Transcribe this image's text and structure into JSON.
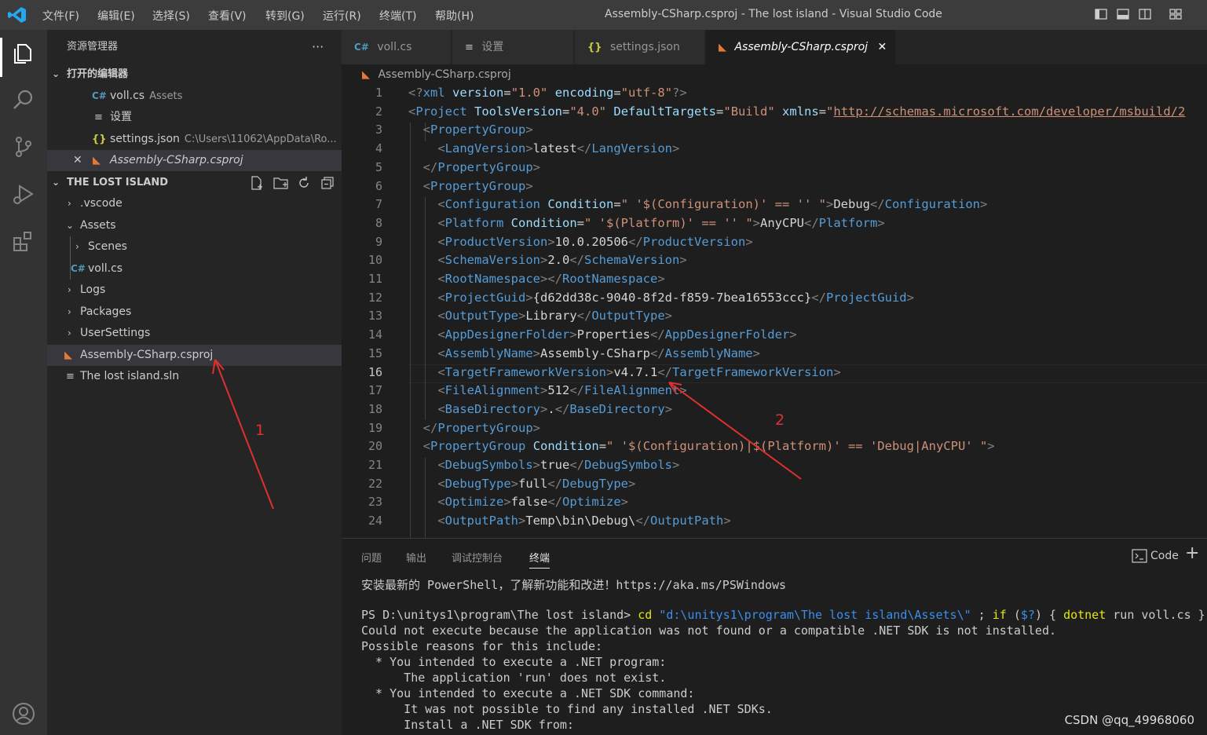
{
  "titlebar": {
    "menus": [
      "文件(F)",
      "编辑(E)",
      "选择(S)",
      "查看(V)",
      "转到(G)",
      "运行(R)",
      "终端(T)",
      "帮助(H)"
    ],
    "title": "Assembly-CSharp.csproj - The lost island - Visual Studio Code"
  },
  "sidebar": {
    "title": "资源管理器",
    "more": "···",
    "open_editors_header": "打开的编辑器",
    "open_editors": [
      {
        "name": "voll.cs",
        "desc": "Assets",
        "icon": "csharp-icon"
      },
      {
        "name": "设置",
        "desc": "",
        "icon": "settings-lines-icon"
      },
      {
        "name": "settings.json",
        "desc": "C:\\Users\\11062\\AppData\\Ro...",
        "icon": "json-icon"
      },
      {
        "name": "Assembly-CSharp.csproj",
        "desc": "",
        "icon": "rss-icon",
        "close": "✕"
      }
    ],
    "folder_header": "THE LOST ISLAND",
    "tree": [
      {
        "name": ".vscode",
        "chevron": "›"
      },
      {
        "name": "Assets",
        "chevron": "⌄"
      },
      {
        "name": "Scenes",
        "chevron": "›"
      },
      {
        "name": "voll.cs",
        "chevron": ""
      },
      {
        "name": "Logs",
        "chevron": "›"
      },
      {
        "name": "Packages",
        "chevron": "›"
      },
      {
        "name": "UserSettings",
        "chevron": "›"
      },
      {
        "name": "Assembly-CSharp.csproj",
        "chevron": ""
      },
      {
        "name": "The lost island.sln",
        "chevron": ""
      }
    ]
  },
  "tabs": [
    {
      "label": "voll.cs"
    },
    {
      "label": "设置"
    },
    {
      "label": "settings.json"
    },
    {
      "label": "Assembly-CSharp.csproj",
      "close": "✕"
    }
  ],
  "breadcrumb": "Assembly-CSharp.csproj",
  "editor": {
    "current_line": 16,
    "line_numbers": [
      "1",
      "2",
      "3",
      "4",
      "5",
      "6",
      "7",
      "8",
      "9",
      "10",
      "11",
      "12",
      "13",
      "14",
      "15",
      "16",
      "17",
      "18",
      "19",
      "20",
      "21",
      "22",
      "23",
      "24"
    ],
    "lines": [
      [
        [
          "br",
          "<?"
        ],
        [
          "tg",
          "xml"
        ],
        [
          "tx",
          " "
        ],
        [
          "at",
          "version"
        ],
        [
          "tx",
          "="
        ],
        [
          "st",
          "\"1.0\""
        ],
        [
          "tx",
          " "
        ],
        [
          "at",
          "encoding"
        ],
        [
          "tx",
          "="
        ],
        [
          "st",
          "\"utf-8\""
        ],
        [
          "br",
          "?>"
        ]
      ],
      [
        [
          "br",
          "<"
        ],
        [
          "tg",
          "Project"
        ],
        [
          "tx",
          " "
        ],
        [
          "at",
          "ToolsVersion"
        ],
        [
          "tx",
          "="
        ],
        [
          "st",
          "\"4.0\""
        ],
        [
          "tx",
          " "
        ],
        [
          "at",
          "DefaultTargets"
        ],
        [
          "tx",
          "="
        ],
        [
          "st",
          "\"Build\""
        ],
        [
          "tx",
          " "
        ],
        [
          "at",
          "xmlns"
        ],
        [
          "tx",
          "="
        ],
        [
          "st",
          "\""
        ],
        [
          "ur",
          "http://schemas.microsoft.com/developer/msbuild/2"
        ]
      ],
      [
        [
          "tx",
          "  "
        ],
        [
          "br",
          "<"
        ],
        [
          "tg",
          "PropertyGroup"
        ],
        [
          "br",
          ">"
        ]
      ],
      [
        [
          "tx",
          "    "
        ],
        [
          "br",
          "<"
        ],
        [
          "tg",
          "LangVersion"
        ],
        [
          "br",
          ">"
        ],
        [
          "tx",
          "latest"
        ],
        [
          "br",
          "</"
        ],
        [
          "tg",
          "LangVersion"
        ],
        [
          "br",
          ">"
        ]
      ],
      [
        [
          "tx",
          "  "
        ],
        [
          "br",
          "</"
        ],
        [
          "tg",
          "PropertyGroup"
        ],
        [
          "br",
          ">"
        ]
      ],
      [
        [
          "tx",
          "  "
        ],
        [
          "br",
          "<"
        ],
        [
          "tg",
          "PropertyGroup"
        ],
        [
          "br",
          ">"
        ]
      ],
      [
        [
          "tx",
          "    "
        ],
        [
          "br",
          "<"
        ],
        [
          "tg",
          "Configuration"
        ],
        [
          "tx",
          " "
        ],
        [
          "at",
          "Condition"
        ],
        [
          "tx",
          "="
        ],
        [
          "st",
          "\" '$(Configuration)' == '' \""
        ],
        [
          "br",
          ">"
        ],
        [
          "tx",
          "Debug"
        ],
        [
          "br",
          "</"
        ],
        [
          "tg",
          "Configuration"
        ],
        [
          "br",
          ">"
        ]
      ],
      [
        [
          "tx",
          "    "
        ],
        [
          "br",
          "<"
        ],
        [
          "tg",
          "Platform"
        ],
        [
          "tx",
          " "
        ],
        [
          "at",
          "Condition"
        ],
        [
          "tx",
          "="
        ],
        [
          "st",
          "\" '$(Platform)' == '' \""
        ],
        [
          "br",
          ">"
        ],
        [
          "tx",
          "AnyCPU"
        ],
        [
          "br",
          "</"
        ],
        [
          "tg",
          "Platform"
        ],
        [
          "br",
          ">"
        ]
      ],
      [
        [
          "tx",
          "    "
        ],
        [
          "br",
          "<"
        ],
        [
          "tg",
          "ProductVersion"
        ],
        [
          "br",
          ">"
        ],
        [
          "tx",
          "10.0.20506"
        ],
        [
          "br",
          "</"
        ],
        [
          "tg",
          "ProductVersion"
        ],
        [
          "br",
          ">"
        ]
      ],
      [
        [
          "tx",
          "    "
        ],
        [
          "br",
          "<"
        ],
        [
          "tg",
          "SchemaVersion"
        ],
        [
          "br",
          ">"
        ],
        [
          "tx",
          "2.0"
        ],
        [
          "br",
          "</"
        ],
        [
          "tg",
          "SchemaVersion"
        ],
        [
          "br",
          ">"
        ]
      ],
      [
        [
          "tx",
          "    "
        ],
        [
          "br",
          "<"
        ],
        [
          "tg",
          "RootNamespace"
        ],
        [
          "br",
          "></"
        ],
        [
          "tg",
          "RootNamespace"
        ],
        [
          "br",
          ">"
        ]
      ],
      [
        [
          "tx",
          "    "
        ],
        [
          "br",
          "<"
        ],
        [
          "tg",
          "ProjectGuid"
        ],
        [
          "br",
          ">"
        ],
        [
          "tx",
          "{d62dd38c-9040-8f2d-f859-7bea16553ccc}"
        ],
        [
          "br",
          "</"
        ],
        [
          "tg",
          "ProjectGuid"
        ],
        [
          "br",
          ">"
        ]
      ],
      [
        [
          "tx",
          "    "
        ],
        [
          "br",
          "<"
        ],
        [
          "tg",
          "OutputType"
        ],
        [
          "br",
          ">"
        ],
        [
          "tx",
          "Library"
        ],
        [
          "br",
          "</"
        ],
        [
          "tg",
          "OutputType"
        ],
        [
          "br",
          ">"
        ]
      ],
      [
        [
          "tx",
          "    "
        ],
        [
          "br",
          "<"
        ],
        [
          "tg",
          "AppDesignerFolder"
        ],
        [
          "br",
          ">"
        ],
        [
          "tx",
          "Properties"
        ],
        [
          "br",
          "</"
        ],
        [
          "tg",
          "AppDesignerFolder"
        ],
        [
          "br",
          ">"
        ]
      ],
      [
        [
          "tx",
          "    "
        ],
        [
          "br",
          "<"
        ],
        [
          "tg",
          "AssemblyName"
        ],
        [
          "br",
          ">"
        ],
        [
          "tx",
          "Assembly-CSharp"
        ],
        [
          "br",
          "</"
        ],
        [
          "tg",
          "AssemblyName"
        ],
        [
          "br",
          ">"
        ]
      ],
      [
        [
          "tx",
          "    "
        ],
        [
          "br",
          "<"
        ],
        [
          "tg",
          "TargetFrameworkVersion"
        ],
        [
          "br",
          ">"
        ],
        [
          "tx",
          "v4.7.1"
        ],
        [
          "br",
          "</"
        ],
        [
          "tg",
          "TargetFrameworkVersion"
        ],
        [
          "br",
          ">"
        ]
      ],
      [
        [
          "tx",
          "    "
        ],
        [
          "br",
          "<"
        ],
        [
          "tg",
          "FileAlignment"
        ],
        [
          "br",
          ">"
        ],
        [
          "tx",
          "512"
        ],
        [
          "br",
          "</"
        ],
        [
          "tg",
          "FileAlignment"
        ],
        [
          "br",
          ">"
        ]
      ],
      [
        [
          "tx",
          "    "
        ],
        [
          "br",
          "<"
        ],
        [
          "tg",
          "BaseDirectory"
        ],
        [
          "br",
          ">"
        ],
        [
          "tx",
          "."
        ],
        [
          "br",
          "</"
        ],
        [
          "tg",
          "BaseDirectory"
        ],
        [
          "br",
          ">"
        ]
      ],
      [
        [
          "tx",
          "  "
        ],
        [
          "br",
          "</"
        ],
        [
          "tg",
          "PropertyGroup"
        ],
        [
          "br",
          ">"
        ]
      ],
      [
        [
          "tx",
          "  "
        ],
        [
          "br",
          "<"
        ],
        [
          "tg",
          "PropertyGroup"
        ],
        [
          "tx",
          " "
        ],
        [
          "at",
          "Condition"
        ],
        [
          "tx",
          "="
        ],
        [
          "st",
          "\" '$(Configuration)|$(Platform)' == 'Debug|AnyCPU' \""
        ],
        [
          "br",
          ">"
        ]
      ],
      [
        [
          "tx",
          "    "
        ],
        [
          "br",
          "<"
        ],
        [
          "tg",
          "DebugSymbols"
        ],
        [
          "br",
          ">"
        ],
        [
          "tx",
          "true"
        ],
        [
          "br",
          "</"
        ],
        [
          "tg",
          "DebugSymbols"
        ],
        [
          "br",
          ">"
        ]
      ],
      [
        [
          "tx",
          "    "
        ],
        [
          "br",
          "<"
        ],
        [
          "tg",
          "DebugType"
        ],
        [
          "br",
          ">"
        ],
        [
          "tx",
          "full"
        ],
        [
          "br",
          "</"
        ],
        [
          "tg",
          "DebugType"
        ],
        [
          "br",
          ">"
        ]
      ],
      [
        [
          "tx",
          "    "
        ],
        [
          "br",
          "<"
        ],
        [
          "tg",
          "Optimize"
        ],
        [
          "br",
          ">"
        ],
        [
          "tx",
          "false"
        ],
        [
          "br",
          "</"
        ],
        [
          "tg",
          "Optimize"
        ],
        [
          "br",
          ">"
        ]
      ],
      [
        [
          "tx",
          "    "
        ],
        [
          "br",
          "<"
        ],
        [
          "tg",
          "OutputPath"
        ],
        [
          "br",
          ">"
        ],
        [
          "tx",
          "Temp\\bin\\Debug\\"
        ],
        [
          "br",
          "</"
        ],
        [
          "tg",
          "OutputPath"
        ],
        [
          "br",
          ">"
        ]
      ]
    ]
  },
  "panel": {
    "tabs": [
      "问题",
      "输出",
      "调试控制台",
      "终端"
    ],
    "active_tab": "终端",
    "terminal_label": "Code",
    "add": "+",
    "terminal_lines": [
      [
        [
          "w",
          "安装最新的 PowerShell，了解新功能和改进！https://aka.ms/PSWindows"
        ]
      ],
      [
        [
          "w",
          ""
        ]
      ],
      [
        [
          "w",
          "PS D:\\unitys1\\program\\The lost island> "
        ],
        [
          "y",
          "cd "
        ],
        [
          "c",
          "\"d:\\unitys1\\program\\The lost island\\Assets\\\""
        ],
        [
          "w",
          " ; "
        ],
        [
          "y",
          "if"
        ],
        [
          "w",
          " ("
        ],
        [
          "c",
          "$?"
        ],
        [
          "w",
          ") { "
        ],
        [
          "y",
          "dotnet"
        ],
        [
          "w",
          " run voll.cs }"
        ]
      ],
      [
        [
          "w",
          "Could not execute because the application was not found or a compatible .NET SDK is not installed."
        ]
      ],
      [
        [
          "w",
          "Possible reasons for this include:"
        ]
      ],
      [
        [
          "w",
          "  * You intended to execute a .NET program:"
        ]
      ],
      [
        [
          "w",
          "      The application 'run' does not exist."
        ]
      ],
      [
        [
          "w",
          "  * You intended to execute a .NET SDK command:"
        ]
      ],
      [
        [
          "w",
          "      It was not possible to find any installed .NET SDKs."
        ]
      ],
      [
        [
          "w",
          "      Install a .NET SDK from:"
        ]
      ]
    ],
    "watermark": "CSDN @qq_49968060"
  },
  "annotations": {
    "label1": "1",
    "label2": "2",
    "color": "#e03030"
  }
}
